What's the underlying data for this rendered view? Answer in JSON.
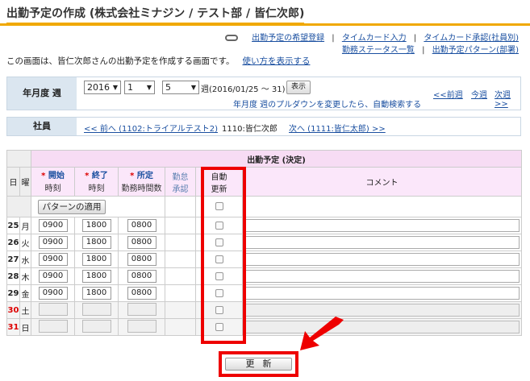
{
  "page_title": "出勤予定の作成 (株式会社ミナジン / テスト部 / 皆仁次郎)",
  "links": {
    "request_wish": "出勤予定の希望登録",
    "timecard_input": "タイムカード入力",
    "timecard_approve": "タイムカード承認(社員別)",
    "status_list": "勤務ステータス一覧",
    "pattern": "出勤予定パターン(部署)"
  },
  "intro": {
    "text": "この画面は、皆仁次郎さんの出勤予定を作成する画面です。",
    "howto": "使い方を表示する"
  },
  "period": {
    "label": "年月度 週",
    "year": "2016",
    "month": "1",
    "week": "5",
    "week_suffix": "週(2016/01/25 〜 31)",
    "show_button": "表示",
    "hint": "年月度 週のプルダウンを変更したら、自動検索する",
    "prev_week": "<<前週",
    "this_week": "今週",
    "next_week": "次週>>"
  },
  "employee": {
    "label": "社員",
    "prev": "<< 前へ (1102:トライアルテスト2)",
    "current": "1110:皆仁次郎",
    "next": "次へ (1111:皆仁太郎) >>"
  },
  "table": {
    "group_header": "出勤予定 (決定)",
    "col_day": "日",
    "col_dow": "曜",
    "col_start": "開始",
    "col_start_sub": "時刻",
    "col_end": "終了",
    "col_end_sub": "時刻",
    "col_sched": "所定",
    "col_sched_sub": "勤務時間数",
    "col_approve": "勤怠",
    "col_approve_sub": "承認",
    "col_auto": "自動",
    "col_auto_sub": "更新",
    "col_comment": "コメント",
    "required_mark": "*",
    "apply_pattern": "パターンの適用",
    "rows": [
      {
        "day": "25",
        "dow": "月",
        "start": "0900",
        "end": "1800",
        "sched": "0800",
        "weekend": false
      },
      {
        "day": "26",
        "dow": "火",
        "start": "0900",
        "end": "1800",
        "sched": "0800",
        "weekend": false
      },
      {
        "day": "27",
        "dow": "水",
        "start": "0900",
        "end": "1800",
        "sched": "0800",
        "weekend": false
      },
      {
        "day": "28",
        "dow": "木",
        "start": "0900",
        "end": "1800",
        "sched": "0800",
        "weekend": false
      },
      {
        "day": "29",
        "dow": "金",
        "start": "0900",
        "end": "1800",
        "sched": "0800",
        "weekend": false
      },
      {
        "day": "30",
        "dow": "土",
        "start": "",
        "end": "",
        "sched": "",
        "weekend": true
      },
      {
        "day": "31",
        "dow": "日",
        "start": "",
        "end": "",
        "sched": "",
        "weekend": true
      }
    ]
  },
  "update_button": "更新",
  "colors": {
    "accent": "#f0a800",
    "highlight": "#e00000",
    "link": "#1a4fa0"
  }
}
